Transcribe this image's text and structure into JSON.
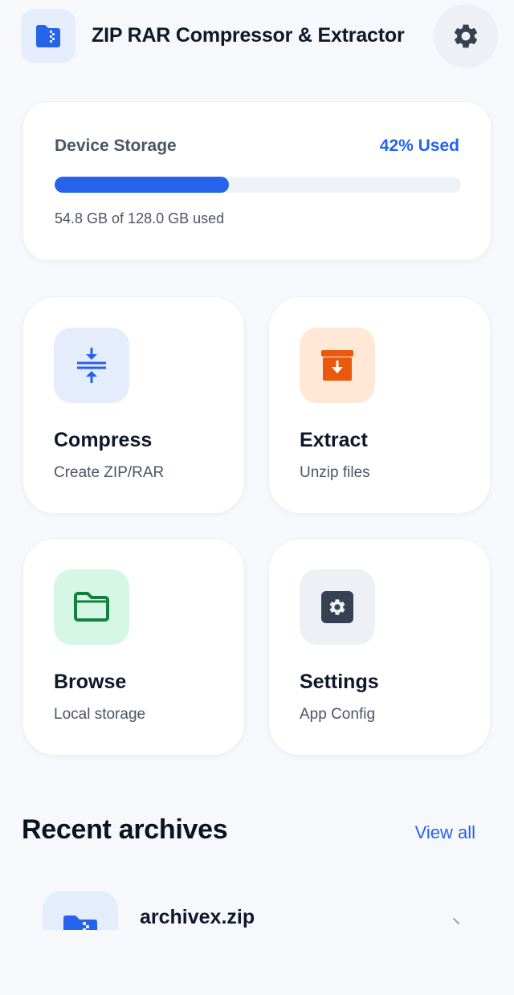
{
  "header": {
    "title": "ZIP RAR Compressor & Extractor",
    "logo_icon": "folder-zip-icon",
    "settings_icon": "gear-icon"
  },
  "storage": {
    "title": "Device Storage",
    "percent_label": "42% Used",
    "used_fraction": 0.428,
    "detail": "54.8 GB of 128.0 GB used",
    "accent": "#2563eb"
  },
  "tiles": [
    {
      "title": "Compress",
      "subtitle": "Create ZIP/RAR",
      "icon": "compress-arrows-icon",
      "icon_bg": "#e5ecfb",
      "icon_color": "#2563eb"
    },
    {
      "title": "Extract",
      "subtitle": "Unzip files",
      "icon": "archive-box-icon",
      "icon_bg": "#ffe9d6",
      "icon_color": "#ea580c"
    },
    {
      "title": "Browse",
      "subtitle": "Local storage",
      "icon": "folder-icon",
      "icon_bg": "#d7f7e6",
      "icon_color": "#15803d"
    },
    {
      "title": "Settings",
      "subtitle": "App Config",
      "icon": "gear-icon",
      "icon_bg": "#edf1f6",
      "icon_color": "#374151"
    }
  ],
  "recent": {
    "title": "Recent archives",
    "view_all": "View all",
    "items": [
      {
        "name": "archivex.zip",
        "icon": "folder-zip-icon"
      }
    ]
  }
}
